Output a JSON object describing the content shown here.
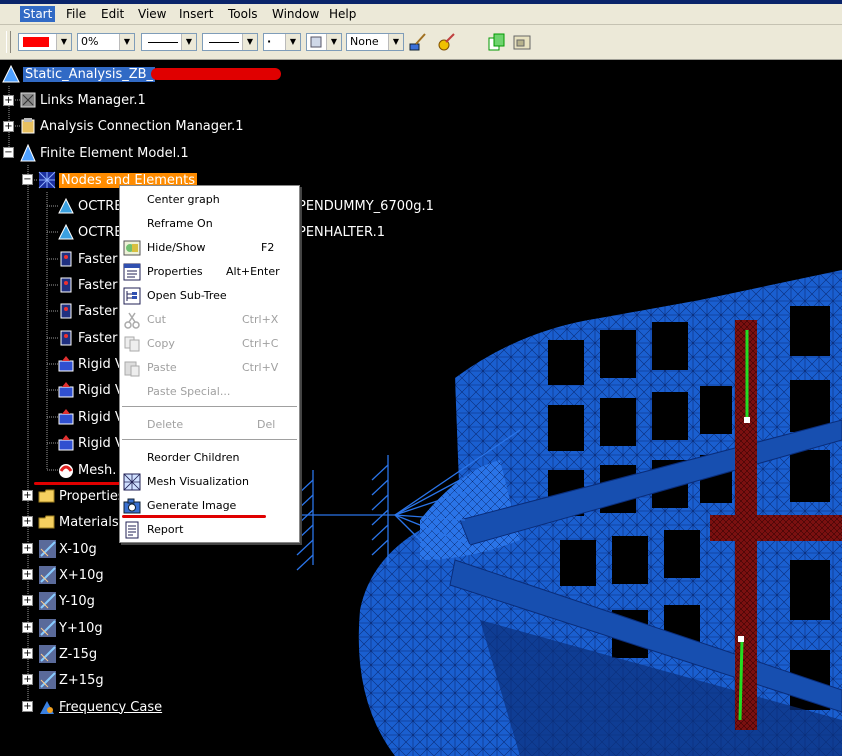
{
  "menubar": {
    "items": [
      "Start",
      "File",
      "Edit",
      "View",
      "Insert",
      "Tools",
      "Window",
      "Help"
    ]
  },
  "toolbar": {
    "color_value": "#ff0000",
    "transparency": "0%",
    "linetype": "",
    "linethickness": "",
    "point_symbol": "·",
    "layer": "None"
  },
  "tree": {
    "root": "Static_Analysis_ZB_",
    "items": {
      "links": "Links Manager.1",
      "acm": "Analysis Connection Manager.1",
      "fem": "Finite Element Model.1",
      "nodes": "Nodes and Elements",
      "octree1_a": "OCTRE",
      "octree1_b": "PENDUMMY_6700g.1",
      "octree2_a": "OCTRE",
      "octree2_b": "PENHALTER.1",
      "fast1": "Faster",
      "fast2": "Faster",
      "fast3": "Faster",
      "fast4": "Faster",
      "rigid1": "Rigid V",
      "rigid2": "Rigid V",
      "rigid3": "Rigid V",
      "rigid4": "Rigid V",
      "mesh": "Mesh.",
      "properties": "Properties",
      "materials": "Materials.",
      "x_neg": "X-10g",
      "x_pos": "X+10g",
      "y_neg": "Y-10g",
      "y_pos": "Y+10g",
      "z_neg": "Z-15g",
      "z_pos": "Z+15g",
      "freq": "Frequency Case"
    }
  },
  "context_menu": {
    "center_graph": "Center graph",
    "reframe_on": "Reframe On",
    "hide_show": "Hide/Show",
    "hide_show_key": "F2",
    "properties": "Properties",
    "properties_key": "Alt+Enter",
    "open_subtree": "Open Sub-Tree",
    "cut": "Cut",
    "cut_key": "Ctrl+X",
    "copy": "Copy",
    "copy_key": "Ctrl+C",
    "paste": "Paste",
    "paste_key": "Ctrl+V",
    "paste_special": "Paste Special...",
    "delete": "Delete",
    "delete_key": "Del",
    "reorder": "Reorder Children",
    "mesh_vis": "Mesh Visualization",
    "generate_image": "Generate Image",
    "report": "Report"
  },
  "colors": {
    "selection": "#316ac5",
    "highlight": "#ff8c00",
    "mesh_blue": "#1a5fd0",
    "annotation_red": "#e00000"
  }
}
